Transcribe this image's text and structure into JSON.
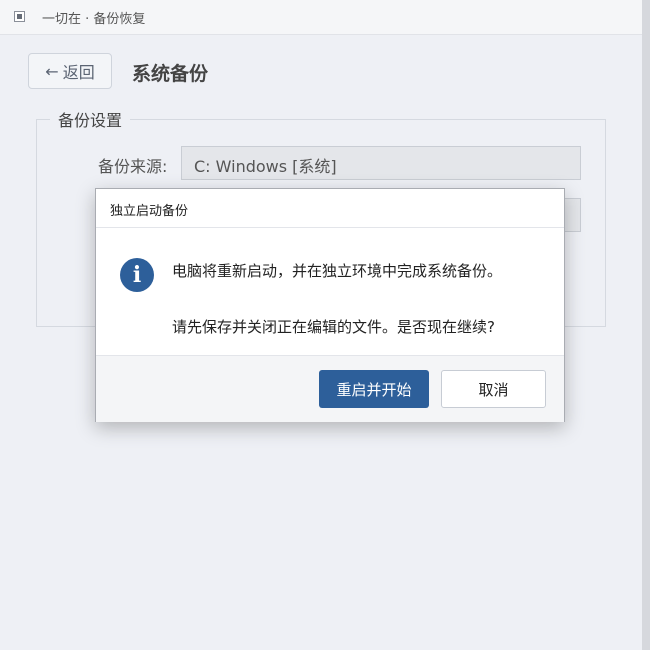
{
  "window": {
    "title": "一切在 · 备份恢复",
    "icon": "app-window-icon"
  },
  "header": {
    "back_label": "返回",
    "back_icon": "←",
    "page_title": "系统备份"
  },
  "settings": {
    "legend": "备份设置",
    "source_label": "备份来源:",
    "source_value": "C: Windows [系统]"
  },
  "dialog": {
    "title": "独立启动备份",
    "icon": "i",
    "message_line1": "电脑将重新启动，并在独立环境中完成系统备份。",
    "message_line2": "请先保存并关闭正在编辑的文件。是否现在继续?",
    "confirm_label": "重启并开始",
    "cancel_label": "取消"
  },
  "colors": {
    "accent": "#2d5f9a",
    "background": "#eef0f5"
  }
}
